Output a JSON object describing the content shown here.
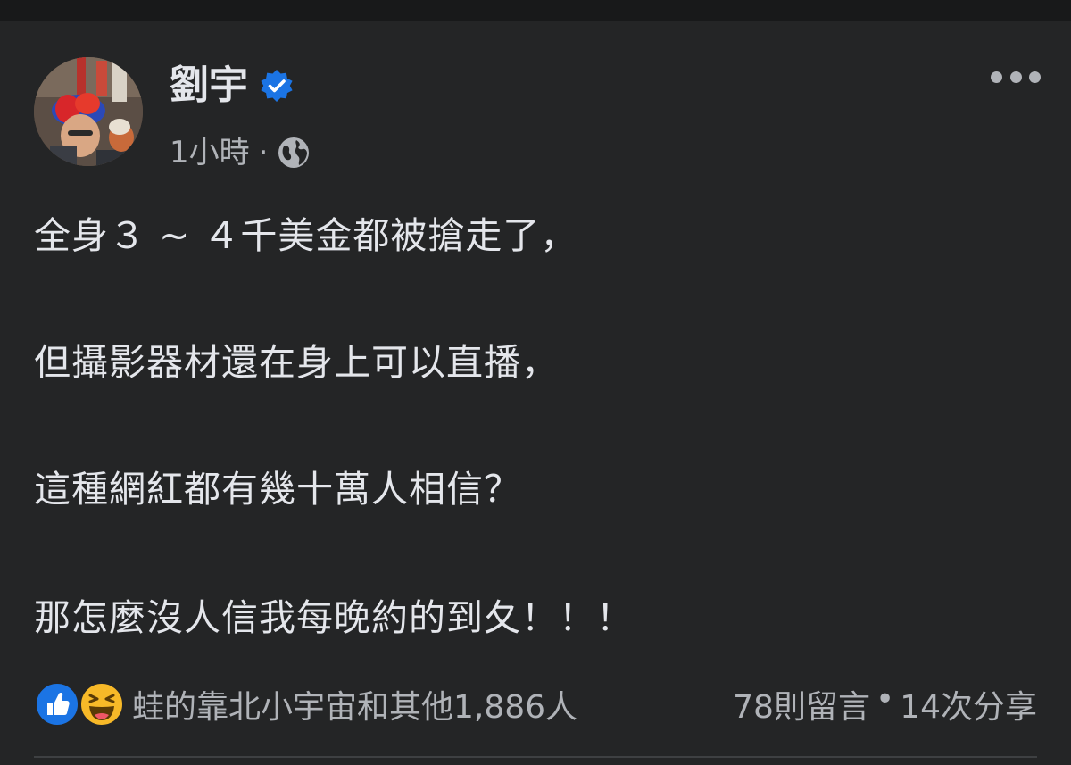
{
  "post": {
    "author": "劉宇",
    "time": "1小時",
    "separator": "·",
    "lines": [
      "全身３ ~ ４千美金都被搶走了，",
      "但攝影器材還在身上可以直播，",
      "這種網紅都有幾十萬人相信？",
      "那怎麼沒人信我每晚約的到夂！！！"
    ]
  },
  "footer": {
    "reactions_text": "蛙的靠北小宇宙和其他1,886人",
    "comments": "78則留言",
    "dot": "•",
    "shares": "14次分享"
  },
  "icons": {
    "verified": "verified-badge-icon",
    "privacy": "globe-icon",
    "more": "more-options-icon",
    "like": "like-reaction-icon",
    "haha": "haha-reaction-icon"
  },
  "colors": {
    "background": "#242526",
    "text_primary": "#e4e6eb",
    "text_secondary": "#b0b3b8",
    "verified_blue": "#1b74e4",
    "haha_yellow": "#f7b928"
  }
}
